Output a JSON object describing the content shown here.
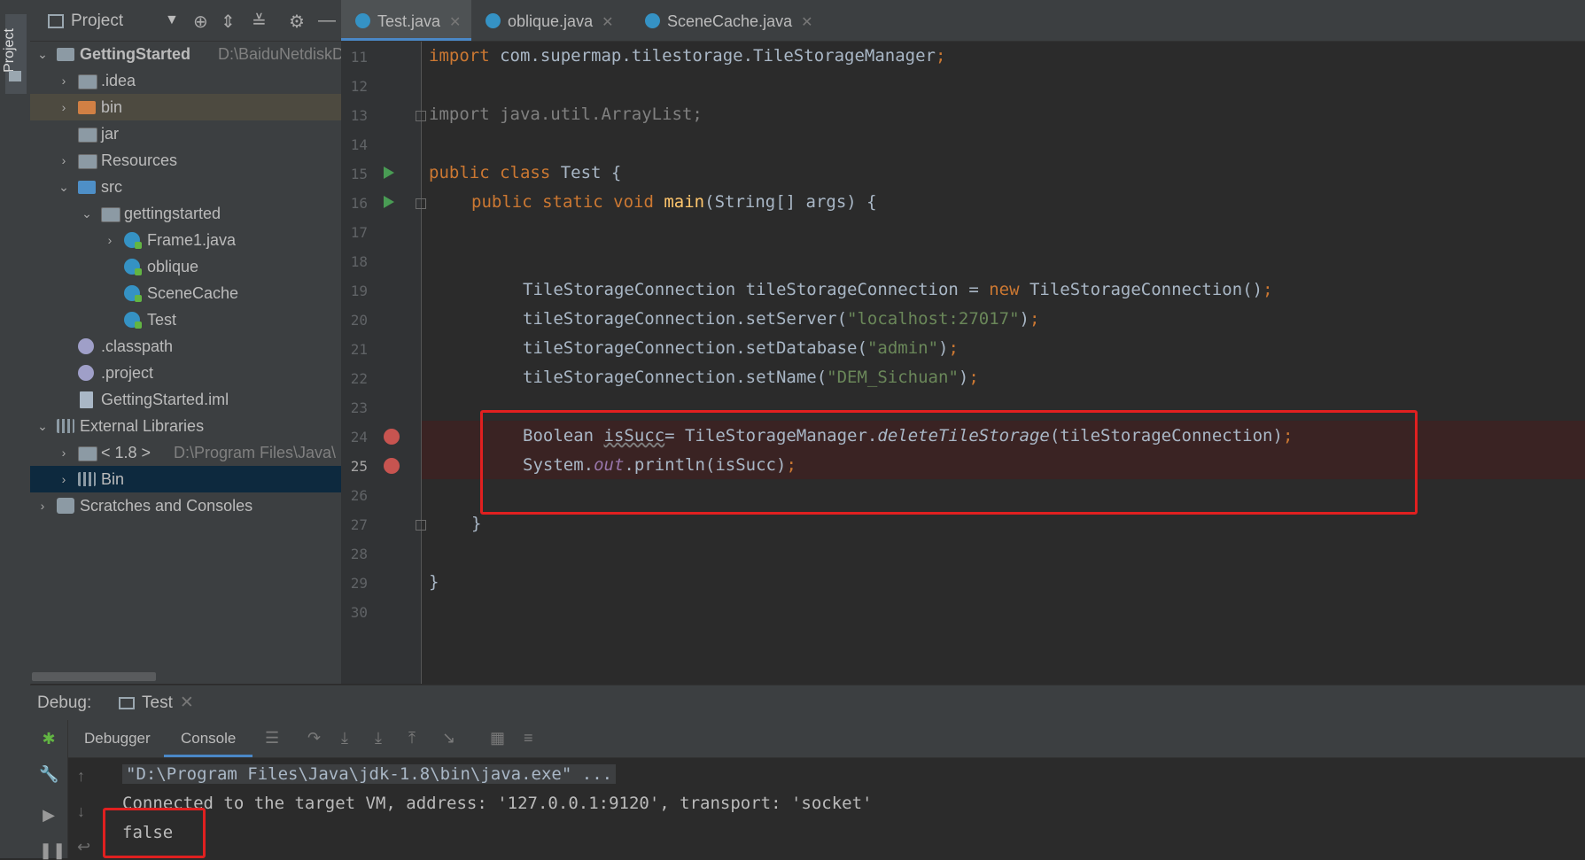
{
  "sidebar_stripe": {
    "label": "Project"
  },
  "project": {
    "title": "Project",
    "tree": [
      {
        "label": "GettingStarted",
        "path": "D:\\BaiduNetdiskD",
        "icon": "project-folder-icon"
      },
      {
        "label": ".idea",
        "icon": "folder-icon"
      },
      {
        "label": "bin",
        "icon": "folder-icon"
      },
      {
        "label": "jar",
        "icon": "folder-icon"
      },
      {
        "label": "Resources",
        "icon": "folder-icon"
      },
      {
        "label": "src",
        "icon": "source-folder-icon"
      },
      {
        "label": "gettingstarted",
        "icon": "package-icon"
      },
      {
        "label": "Frame1.java",
        "icon": "java-class-icon"
      },
      {
        "label": "oblique",
        "icon": "java-class-icon"
      },
      {
        "label": "SceneCache",
        "icon": "java-class-icon"
      },
      {
        "label": "Test",
        "icon": "java-class-icon"
      },
      {
        "label": ".classpath",
        "icon": "file-icon"
      },
      {
        "label": ".project",
        "icon": "file-icon"
      },
      {
        "label": "GettingStarted.iml",
        "icon": "iml-file-icon"
      },
      {
        "label": "External Libraries",
        "icon": "library-icon"
      },
      {
        "label": "< 1.8 >",
        "path": "D:\\Program Files\\Java\\",
        "icon": "jdk-icon"
      },
      {
        "label": "Bin",
        "icon": "library-icon"
      },
      {
        "label": "Scratches and Consoles",
        "icon": "scratches-icon"
      }
    ]
  },
  "editor": {
    "tabs": [
      {
        "label": "Test.java",
        "active": true
      },
      {
        "label": "oblique.java",
        "active": false
      },
      {
        "label": "SceneCache.java",
        "active": false
      }
    ],
    "line_numbers": [
      "11",
      "12",
      "13",
      "14",
      "15",
      "16",
      "17",
      "18",
      "19",
      "20",
      "21",
      "22",
      "23",
      "24",
      "25",
      "26",
      "27",
      "28",
      "29",
      "30"
    ],
    "code": {
      "l11_kw": "import",
      "l11_rest": " com.supermap.tilestorage.TileStorageManager",
      "l11_semi": ";",
      "l13": "import java.util.ArrayList;",
      "l15_kw": "public class",
      "l15_rest": " Test {",
      "l16_kw": "public static void",
      "l16_fn": "main",
      "l16_rest": "(String[] args) {",
      "l19_a": "TileStorageConnection tileStorageConnection = ",
      "l19_kw": "new",
      "l19_b": " TileStorageConnection()",
      "l19_semi": ";",
      "l20_a": "tileStorageConnection.setServer(",
      "l20_str": "\"localhost:27017\"",
      "l20_b": ")",
      "l20_semi": ";",
      "l21_a": "tileStorageConnection.setDatabase(",
      "l21_str": "\"admin\"",
      "l21_b": ")",
      "l21_semi": ";",
      "l22_a": "tileStorageConnection.setName(",
      "l22_str": "\"DEM_Sichuan\"",
      "l22_b": ")",
      "l22_semi": ";",
      "l24_a": "Boolean ",
      "l24_var": "isSucc",
      "l24_b": "= TileStorageManager.",
      "l24_it": "deleteTileStorage",
      "l24_c": "(tileStorageConnection)",
      "l24_semi": ";",
      "l25_a": "System.",
      "l25_fld": "out",
      "l25_b": ".println(isSucc)",
      "l25_semi": ";",
      "l27": "}",
      "l29": "}"
    }
  },
  "debug": {
    "label": "Debug:",
    "run_tab": "Test",
    "tabs": {
      "debugger": "Debugger",
      "console": "Console"
    },
    "console_lines": {
      "cmd": "\"D:\\Program Files\\Java\\jdk-1.8\\bin\\java.exe\" ...",
      "connected": "Connected to the target VM, address: '127.0.0.1:9120', transport: 'socket'",
      "result": "false"
    }
  },
  "colors": {
    "highlight_box": "#e02020",
    "breakpoint": "#c75450",
    "accent": "#4a88c7"
  }
}
